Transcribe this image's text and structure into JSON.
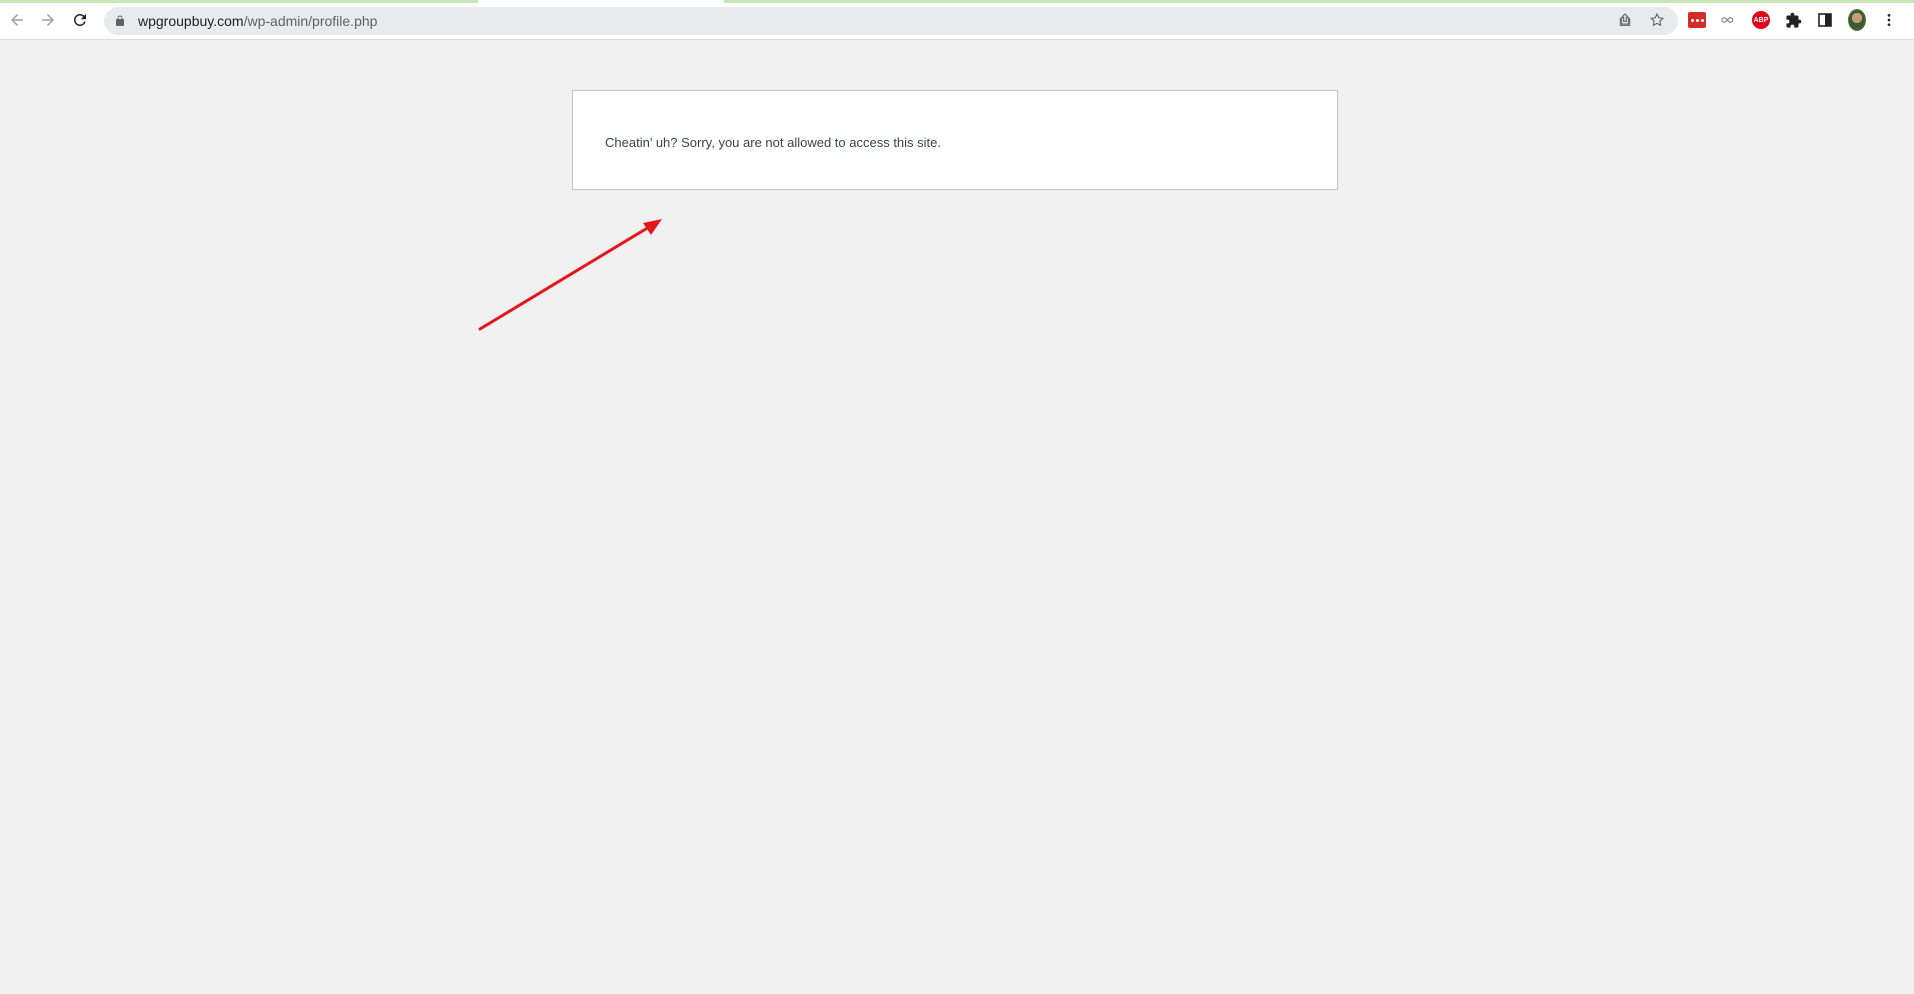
{
  "browser": {
    "url_host": "wpgroupbuy.com",
    "url_path": "/wp-admin/profile.php",
    "icons": {
      "back": "arrow-left-icon",
      "forward": "arrow-right-icon",
      "reload": "reload-icon",
      "lock": "lock-icon",
      "share": "share-icon",
      "bookmark": "star-icon",
      "extensions": [
        "lastpass-icon",
        "infinity-icon",
        "abp-icon",
        "puzzle-icon",
        "sidepanel-icon"
      ],
      "profile": "avatar",
      "menu": "kebab-menu-icon"
    },
    "abp_label": "ABP",
    "load_strip_color": "#c7e6b8"
  },
  "page": {
    "message": "Cheatin’ uh? Sorry, you are not allowed to access this site.",
    "background_color": "#f0f0f0",
    "box_border_color": "#c3c4c7"
  },
  "annotation": {
    "type": "arrow",
    "color": "#e3161b"
  }
}
